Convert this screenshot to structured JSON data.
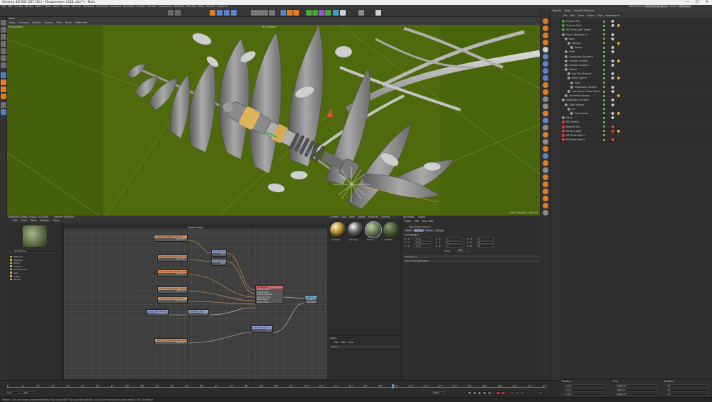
{
  "window": {
    "title": "Cinema 4D R21.207 (RC) - [Suspension 2021.c4d *] - Main",
    "min_label": "—",
    "max_label": "☐",
    "close_label": "✕"
  },
  "menubar": [
    "File",
    "Edit",
    "Create",
    "Modes",
    "Select",
    "Tools",
    "Mesh",
    "Spline",
    "Volume",
    "MoGraph",
    "Character",
    "Animate",
    "Simulate",
    "Tracker",
    "Render",
    "Extensions",
    "Redshift",
    "Window",
    "Help",
    "Octane",
    "Insydium"
  ],
  "layout_label": "Node Space:",
  "layout_value": "Standard Renderer",
  "layout2_label": "Layout:",
  "layout2_value": "Standard",
  "viewport": {
    "title": "View",
    "menus": [
      "View",
      "Cameras",
      "Display",
      "Options",
      "Filter",
      "Panel",
      "ProRender"
    ],
    "camera_label": "Perspective",
    "grid_label": "Grid Spacing : 100 cm",
    "scene_label": "Rt_Camera"
  },
  "object_manager": {
    "tabs": [
      "Objects",
      "Takes",
      "Content Browser"
    ],
    "menus": [
      "File",
      "Edit",
      "View",
      "Object",
      "Tags",
      "Bookmarks"
    ],
    "objects": [
      {
        "name": "Physical Sky",
        "indent": 0,
        "color": "#4ca53f"
      },
      {
        "name": "Physical Sky.1",
        "indent": 0,
        "color": "#4ca53f"
      },
      {
        "name": "RS Dome Light Target",
        "indent": 0,
        "color": "#4ca53f"
      },
      {
        "name": "Shock Absorber v2",
        "indent": 0,
        "color": "#9a9a9a"
      },
      {
        "name": "Body",
        "indent": 1,
        "color": "#9a9a9a"
      },
      {
        "name": "Spring.1",
        "indent": 2,
        "color": "#9a9a9a"
      },
      {
        "name": "Spring",
        "indent": 3,
        "color": "#9a9a9a"
      },
      {
        "name": "Shaft",
        "indent": 1,
        "color": "#9a9a9a"
      },
      {
        "name": "Subdivision Surface.1",
        "indent": 1,
        "color": "#9a9a9a"
      },
      {
        "name": "Cylinder Smooth",
        "indent": 1,
        "color": "#9a9a9a"
      },
      {
        "name": "Cylinder Smooth.1",
        "indent": 1,
        "color": "#9a9a9a"
      },
      {
        "name": "Bottom",
        "indent": 1,
        "color": "#9a9a9a"
      },
      {
        "name": "Sub Prim Bump.1",
        "indent": 2,
        "color": "#9a9a9a"
      },
      {
        "name": "Bump Sketch",
        "indent": 2,
        "color": "#9a9a9a"
      },
      {
        "name": "Tube",
        "indent": 3,
        "color": "#9a9a9a"
      },
      {
        "name": "Subdivision Surface",
        "indent": 3,
        "color": "#9a9a9a"
      },
      {
        "name": "Sub Surface Down Shock",
        "indent": 2,
        "color": "#9a9a9a"
      },
      {
        "name": "Connector Springs",
        "indent": 1,
        "color": "#9a9a9a"
      },
      {
        "name": "Subdivision Surface",
        "indent": 0,
        "color": "#9a9a9a"
      },
      {
        "name": "Cloth Surface",
        "indent": 1,
        "color": "#9a9a9a"
      },
      {
        "name": "Ivy",
        "indent": 2,
        "color": "#9a9a9a"
      },
      {
        "name": "Fern.Leaves",
        "indent": 3,
        "color": "#9a9a9a"
      },
      {
        "name": "Plane",
        "indent": 0,
        "color": "#9a9a9a"
      },
      {
        "name": "RS Camera",
        "indent": 0,
        "color": "#d9443a"
      },
      {
        "name": "Redshift Sky",
        "indent": 0,
        "color": "#d9443a"
      },
      {
        "name": "RS Area Light",
        "indent": 0,
        "color": "#d9443a"
      },
      {
        "name": "RS Dome Light.1",
        "indent": 0,
        "color": "#d9443a"
      },
      {
        "name": "RS Dome Light.2",
        "indent": 0,
        "color": "#d9443a"
      }
    ]
  },
  "node_editor": {
    "header_tabs": [
      "Redshift Shader Graph - RS Fern",
      "Render Settings"
    ],
    "menus": [
      "Edit",
      "View",
      "Tools",
      "Options",
      "Help"
    ],
    "canvas_title": "Shader Graph",
    "tree_title": "Find Nodes...",
    "tree_items": [
      "Materials",
      "Textures",
      "Utility",
      "Volume",
      "Environment",
      "AOV",
      "Lights",
      "Output"
    ],
    "nodes": [
      {
        "title": "Color_tex_Diffuse - Texture",
        "out": "Out Color"
      },
      {
        "title": "Color_tex_Translucency - Texture",
        "out": "Out Color"
      },
      {
        "title": "Color_tex_Roughness - Texture",
        "out": "Out Color"
      },
      {
        "title": "Color_tex_Specular - Texture",
        "out": "Out Color"
      },
      {
        "title": "Color_tex_Gloss - Texture",
        "out": "Out Color"
      },
      {
        "title": "Color_tex_Normal - Texture",
        "out": "Out Color"
      },
      {
        "title": "Color_tex_Displacement - Texture",
        "out": "Out Color"
      },
      {
        "title": "RS Math Abs",
        "out": "Out"
      },
      {
        "title": "RS Math Abs",
        "out": "Out"
      },
      {
        "title": "RS Bump Map",
        "out": "Out"
      },
      {
        "title": "RS Displacement",
        "out": "Out"
      },
      {
        "title": "RS Material",
        "rows": [
          "Diffuse Color",
          "Transl Color",
          "Refl Roughness",
          "Opacity Color",
          "Refl Weight",
          "Bump Input"
        ]
      },
      {
        "title": "Output",
        "rows": [
          "Surface",
          "Displacement"
        ]
      }
    ]
  },
  "materials": {
    "tabs": [
      "Create",
      "Edit",
      "View",
      "Select",
      "Material",
      "Texture"
    ],
    "items": [
      "RS Metal",
      "RS Glass",
      "RS Fern",
      "RS Mat"
    ],
    "layer_tabs": [
      "Layer"
    ],
    "layer_menus": [
      "File",
      "Edit",
      "View"
    ],
    "layer_col": "Name"
  },
  "attributes": {
    "tabs": [
      "Attributes",
      "Layers"
    ],
    "menus": [
      "Mode",
      "Edit",
      "User Data"
    ],
    "object_label": "Plane Object [Plane]",
    "sub_tabs": [
      "Basic",
      "Coord.",
      "Object",
      "Phong"
    ],
    "section": "Coordinates",
    "rows": [
      {
        "a": "P . X",
        "av": "0 cm",
        "b": "S . X",
        "bv": "1",
        "c": "R . H",
        "cv": "0°"
      },
      {
        "a": "P . Y",
        "av": "0 cm",
        "b": "S . Y",
        "bv": "1",
        "c": "R . P",
        "cv": "0°"
      },
      {
        "a": "P . Z",
        "av": "0 cm",
        "b": "S . Z",
        "bv": "1",
        "c": "R . B",
        "cv": "0°"
      }
    ],
    "order_label": "Order",
    "order_value": "HPB",
    "frozen": "Freeze Transformation",
    "quat": "Quaternion"
  },
  "coord_manager": {
    "cols": [
      "Position",
      "Size",
      "Rotation"
    ],
    "x": [
      "0 cm",
      "1006 cm",
      "0°"
    ],
    "y": [
      "0 cm",
      "406 cm",
      "0°"
    ],
    "z": [
      "0 cm",
      "1600 cm",
      "0°"
    ],
    "mode": "Object (Rel)",
    "size_mode": "Size",
    "apply": "Apply"
  },
  "timeline": {
    "ticks": [
      "0",
      "5",
      "10",
      "15",
      "20",
      "25",
      "30",
      "35",
      "40",
      "45",
      "50",
      "55",
      "60",
      "65",
      "70",
      "75",
      "80",
      "85",
      "90",
      "95",
      "100",
      "105",
      "110",
      "115",
      "120",
      "125",
      "130",
      "135",
      "140",
      "145",
      "150",
      "155",
      "160",
      "165",
      "170",
      "175",
      "180"
    ],
    "start": "0 F",
    "end": "180 F",
    "current": "0 F"
  },
  "status": "Rotate: Click and drag to rotate elements. Hold down SHIFT to quantize rotation / add to the selection in point mode, CTRL to remove."
}
